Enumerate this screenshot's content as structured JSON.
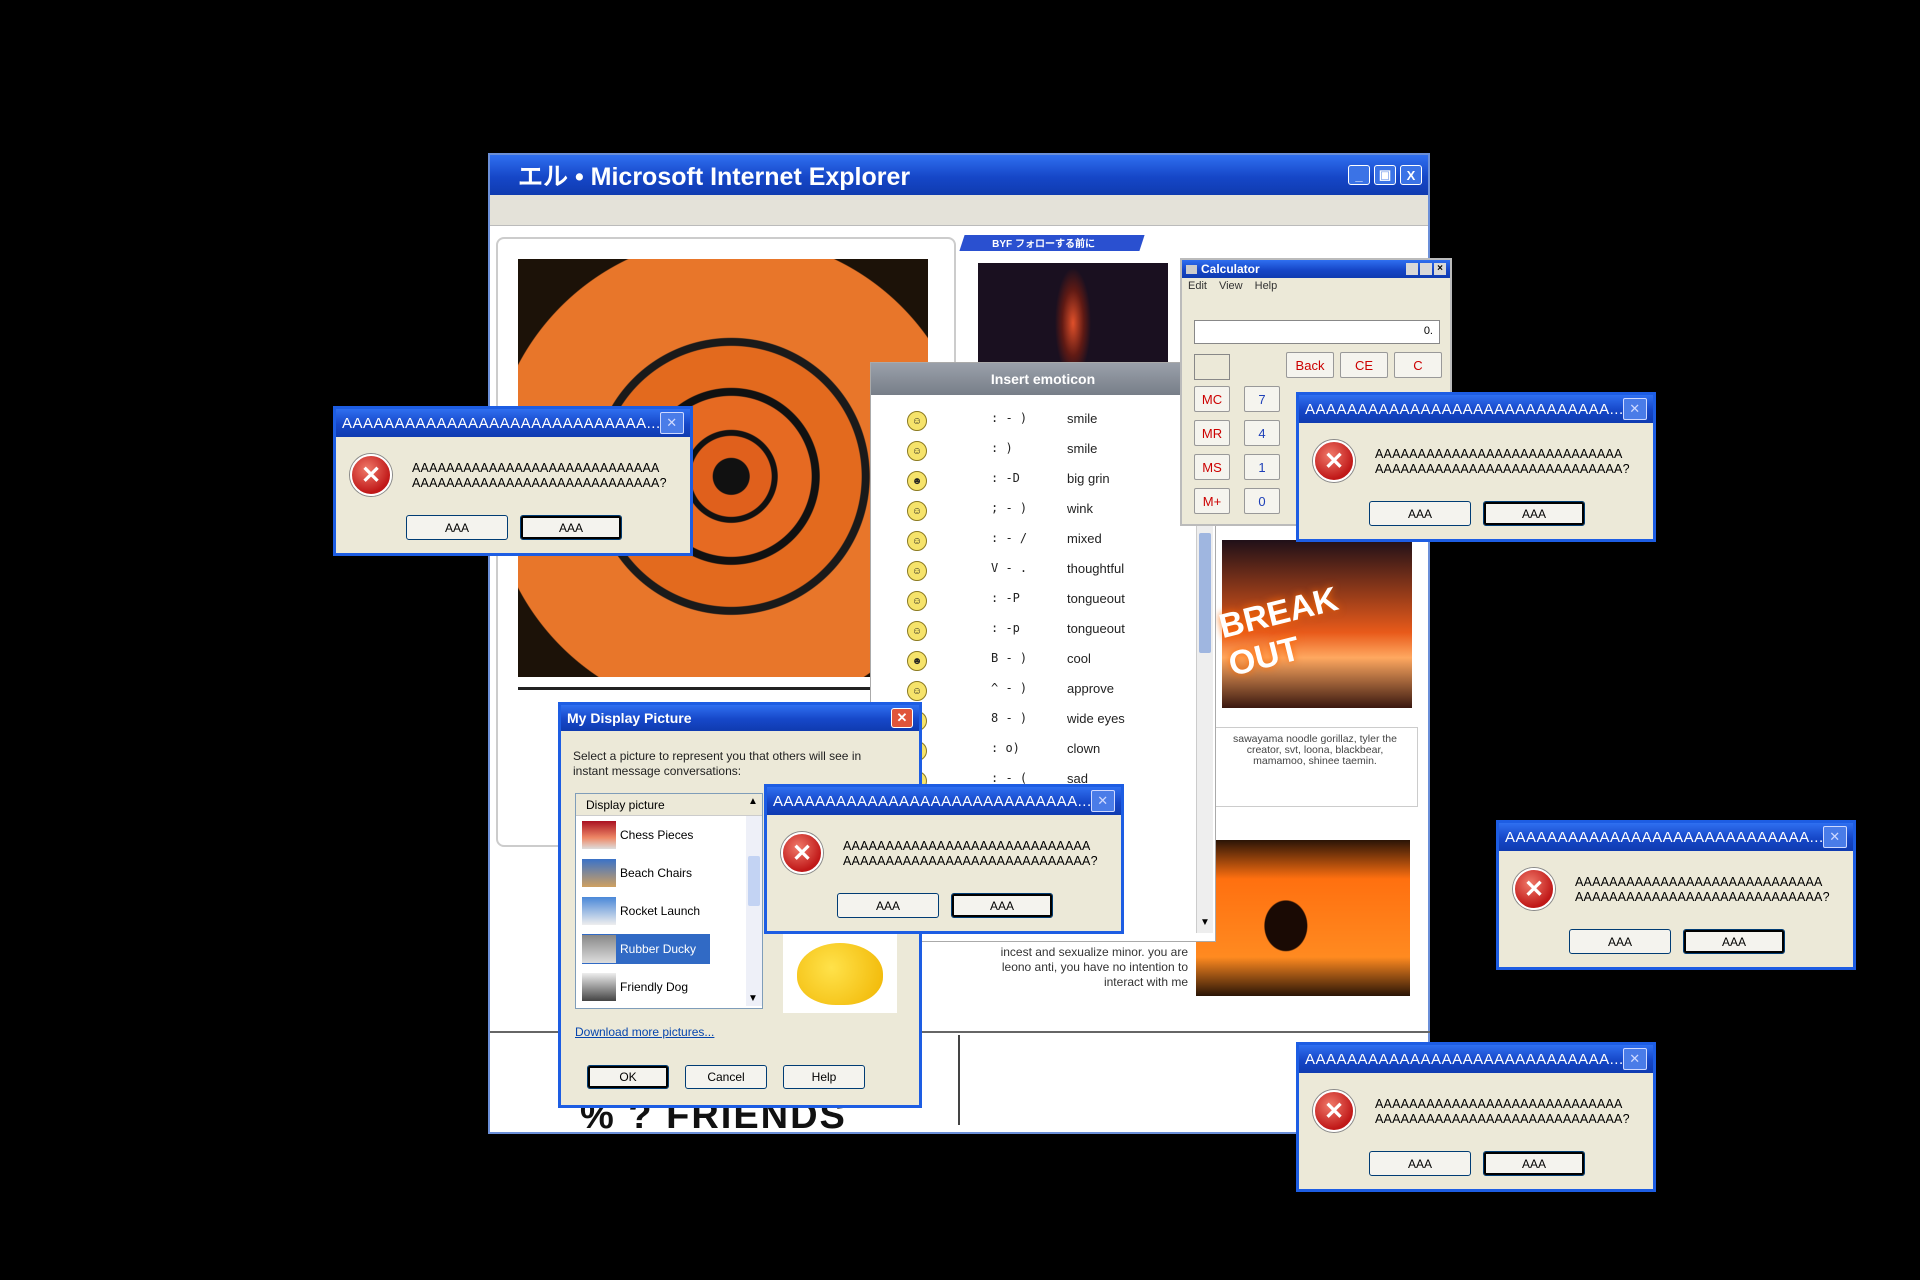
{
  "ie": {
    "title": "エル • Microsoft Internet Explorer",
    "minimize": "_",
    "maximize": "▣",
    "close": "X"
  },
  "page": {
    "banner": "BYF フォローする前に",
    "caption": "sawayama noodle gorillaz, tyler the creator, svt, loona, blackbear, mamamoo, shinee taemin.",
    "warning": "incest and sexualize minor. you are leono anti, you have no intention to interact with me",
    "bottom_text": "% ? FRIENDS",
    "neon_text": "BREAK OUT"
  },
  "calculator": {
    "title": "Calculator",
    "menu": [
      "Edit",
      "View",
      "Help"
    ],
    "display": "0.",
    "back": "Back",
    "ce": "CE",
    "c": "C",
    "mem": [
      "MC",
      "MR",
      "MS",
      "M+"
    ],
    "digits": [
      "7",
      "4",
      "1",
      "0"
    ]
  },
  "emoticons": {
    "title": "Insert emoticon",
    "items": [
      {
        "code": ": - )",
        "name": "smile"
      },
      {
        "code": ": )",
        "name": "smile"
      },
      {
        "code": ": -D",
        "name": "big grin"
      },
      {
        "code": "; - )",
        "name": "wink"
      },
      {
        "code": ": - /",
        "name": "mixed"
      },
      {
        "code": "V - .",
        "name": "thoughtful"
      },
      {
        "code": ": -P",
        "name": "tongueout"
      },
      {
        "code": ": -p",
        "name": "tongueout"
      },
      {
        "code": "B - )",
        "name": "cool"
      },
      {
        "code": "^ - )",
        "name": "approve"
      },
      {
        "code": "8 - )",
        "name": "wide eyes"
      },
      {
        "code": ": o)",
        "name": "clown"
      },
      {
        "code": ": - (",
        "name": "sad"
      }
    ]
  },
  "display_picture": {
    "title": "My Display Picture",
    "description": "Select a picture to represent you that others will see in instant message conversations:",
    "list_header": "Display picture",
    "items": [
      "Chess Pieces",
      "Beach Chairs",
      "Rocket Launch",
      "Rubber Ducky",
      "Friendly Dog"
    ],
    "selected": "Rubber Ducky",
    "link": "Download more pictures...",
    "ok": "OK",
    "cancel": "Cancel",
    "help": "Help"
  },
  "error_dialog": {
    "title": "AAAAAAAAAAAAAAAAAAAAAAAAAAAAA...",
    "line1": "AAAAAAAAAAAAAAAAAAAAAAAAAAAAA",
    "line2": "AAAAAAAAAAAAAAAAAAAAAAAAAAAAA?",
    "button1": "AAA",
    "button2": "AAA"
  },
  "colors": {
    "accent": "#1d5de3",
    "error_red": "#c01818",
    "background": "#000000"
  }
}
